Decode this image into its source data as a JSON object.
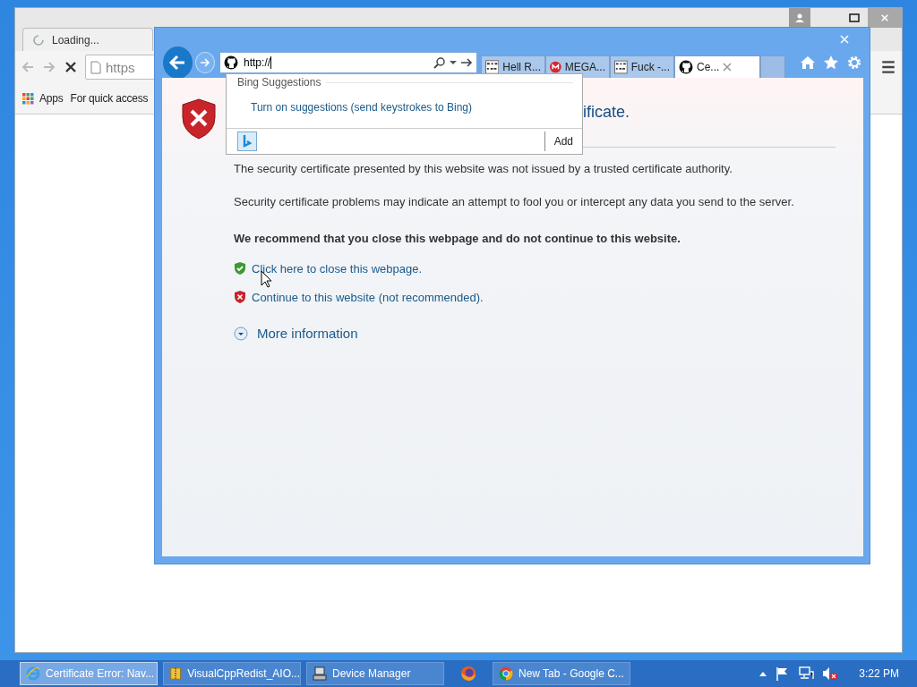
{
  "chrome_window": {
    "tab": {
      "title": "Loading..."
    },
    "address": "https",
    "bookmarks": [
      {
        "label": "Apps",
        "kind": "apps"
      },
      {
        "label": "For quick access",
        "kind": "text"
      }
    ]
  },
  "ie_window": {
    "address": "http://",
    "tabs": [
      {
        "title": "Hell R...",
        "kind": "binary",
        "selected": false
      },
      {
        "title": "MEGA...",
        "kind": "mega",
        "selected": false
      },
      {
        "title": "Fuck -...",
        "kind": "binary",
        "selected": false
      },
      {
        "title": "Ce...",
        "kind": "github",
        "selected": true
      }
    ],
    "suggestions": {
      "heading": "Bing Suggestions",
      "link": "Turn on suggestions (send keystrokes to Bing)",
      "add_button": "Add"
    },
    "page": {
      "heading": "ificate.",
      "paragraphs": [
        "The security certificate presented by this website was not issued by a trusted certificate authority.",
        "Security certificate problems may indicate an attempt to fool you or intercept any data you send to the server."
      ],
      "recommendation": "We recommend that you close this webpage and do not continue to this website.",
      "options": [
        {
          "kind": "close",
          "text": "Click here to close this webpage."
        },
        {
          "kind": "continue",
          "text": "Continue to this website (not recommended)."
        }
      ],
      "more_info": "More information"
    }
  },
  "taskbar": {
    "items": [
      {
        "label": "Certificate Error: Nav...",
        "kind": "ie",
        "selected": true
      },
      {
        "label": "VisualCppRedist_AIO...",
        "kind": "archive",
        "selected": false
      },
      {
        "label": "Device Manager",
        "kind": "device",
        "selected": false
      },
      {
        "kind": "firefox",
        "selected": false
      },
      {
        "label": "New Tab - Google C...",
        "kind": "chrome",
        "selected": false
      }
    ],
    "clock": "3:22 PM"
  }
}
